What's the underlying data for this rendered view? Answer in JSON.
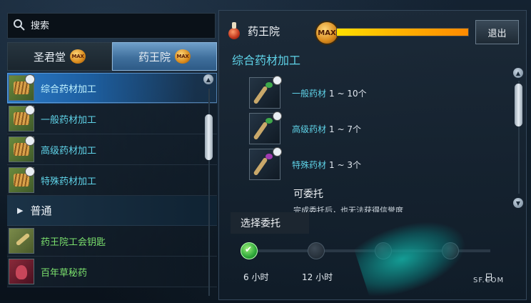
{
  "search": {
    "placeholder": "搜索"
  },
  "tabs": [
    {
      "label": "圣君堂",
      "badge": "MAX",
      "active": false
    },
    {
      "label": "药王院",
      "badge": "MAX",
      "active": true
    }
  ],
  "list": {
    "rows": [
      {
        "label": "综合药材加工",
        "selected": true
      },
      {
        "label": "一般药材加工",
        "selected": false
      },
      {
        "label": "高级药材加工",
        "selected": false
      },
      {
        "label": "特殊药材加工",
        "selected": false
      }
    ],
    "category": {
      "label": "普通"
    },
    "items": [
      {
        "label": "药王院工会钥匙"
      },
      {
        "label": "百年草秘药"
      }
    ]
  },
  "detail": {
    "title": "药王院",
    "max_badge": "MAX",
    "exp_progress": 1.0,
    "exit_label": "退出",
    "subtitle": "综合药材加工",
    "materials": [
      {
        "name": "一般药材",
        "qty": "1 ~ 10个",
        "leaf": "green"
      },
      {
        "name": "高级药材",
        "qty": "1 ~ 7个",
        "leaf": "green"
      },
      {
        "name": "特殊药材",
        "qty": "1 ~ 3个",
        "leaf": "purple"
      }
    ],
    "entrust_title": "可委托",
    "entrust_note": "完成委托后，也无法获得信誉度",
    "choose_label": "选择委托",
    "duration_options": [
      "6 小时",
      "12 小时",
      "",
      "日"
    ],
    "selected_duration": 0,
    "watermark": "SF.COM"
  },
  "colors": {
    "accent_cyan": "#5fd3e8",
    "item_green": "#7be06d",
    "progress_yellow": "#ffd000",
    "selected_blue": "#2a79c7"
  }
}
